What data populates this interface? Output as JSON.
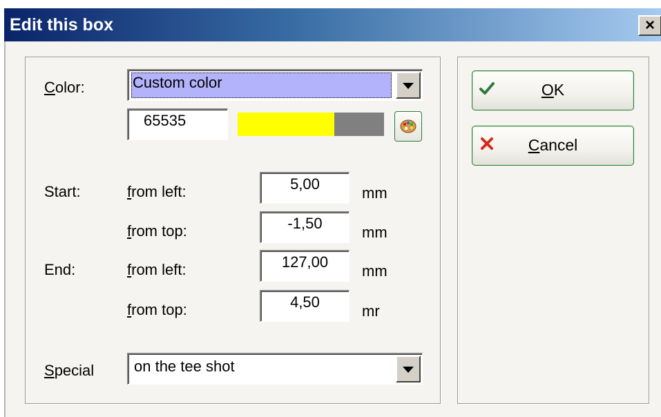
{
  "window": {
    "title": "Edit this box",
    "close_label": "×"
  },
  "color": {
    "label_u": "C",
    "label_rest": "olor:",
    "selected": "Custom color",
    "value": "65535",
    "swatch_hex": "#ffff00",
    "fill_fraction": 0.66
  },
  "start": {
    "label": "Start:",
    "from_left": {
      "label_u": "f",
      "label_rest": "rom left:",
      "value": "5,00",
      "unit": "mm"
    },
    "from_top": {
      "label_u": "f",
      "label_rest": "rom top:",
      "value": "-1,50",
      "unit": "mm"
    }
  },
  "end": {
    "label": "End:",
    "from_left": {
      "label_u": "f",
      "label_rest": "rom left:",
      "value": "127,00",
      "unit": "mm"
    },
    "from_top": {
      "label_u": "f",
      "label_rest": "rom top:",
      "value": "4,50",
      "unit": "mr"
    }
  },
  "special": {
    "label_u": "S",
    "label_rest": "pecial",
    "selected": "on the tee shot"
  },
  "buttons": {
    "ok": {
      "label_u": "O",
      "label_rest": "K",
      "icon": "check-icon",
      "accent": "#2f7a3a"
    },
    "cancel": {
      "label_u": "C",
      "label_rest": "ancel",
      "icon": "x-icon",
      "accent": "#d8281c"
    }
  }
}
